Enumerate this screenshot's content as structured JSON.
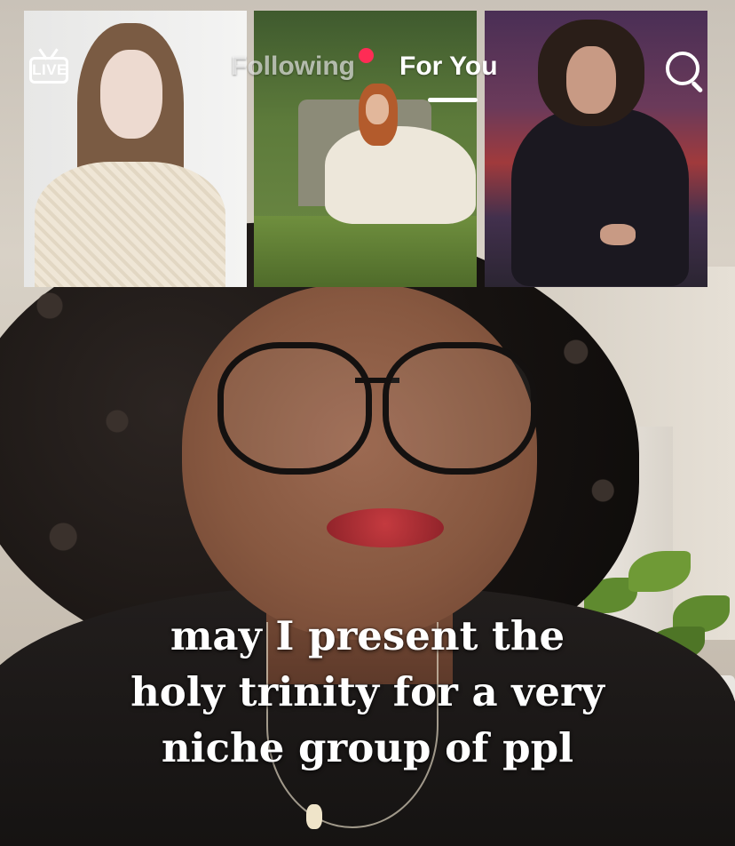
{
  "topbar": {
    "live_label": "LIVE",
    "tabs": [
      {
        "label": "Following",
        "active": false,
        "has_notification_dot": true
      },
      {
        "label": "For You",
        "active": true
      }
    ],
    "search_icon": "search-icon",
    "notification_dot_color": "#fe2c55"
  },
  "video": {
    "caption_lines": [
      "may I present the",
      "holy trinity for a very",
      "niche group of ppl"
    ],
    "overlay_photo_count": 3
  }
}
